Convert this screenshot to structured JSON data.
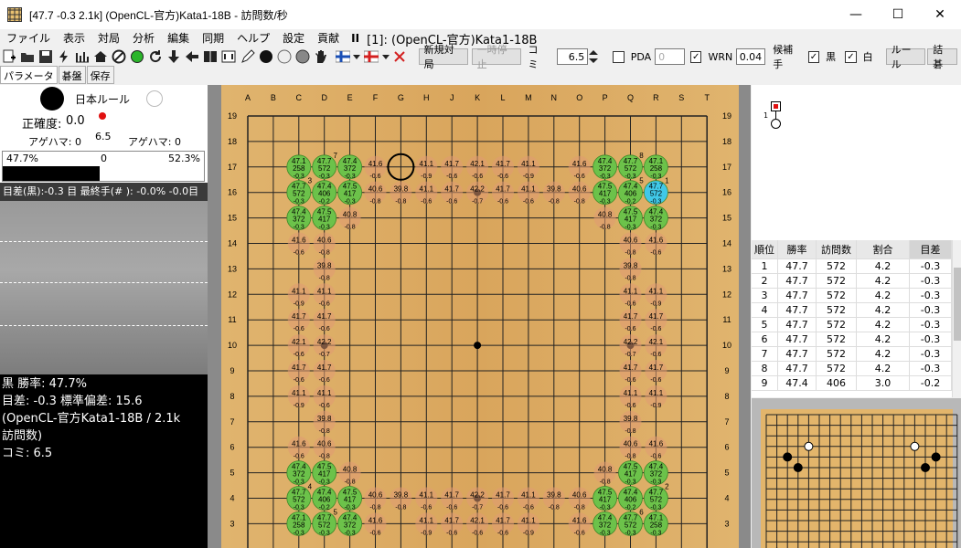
{
  "window": {
    "title": "[47.7 -0.3 2.1k] (OpenCL-官方)Kata1-18B - 訪問数/秒",
    "min": "—",
    "max": "☐",
    "close": "✕"
  },
  "menu": {
    "items": [
      "ファイル",
      "表示",
      "対局",
      "分析",
      "編集",
      "同期",
      "ヘルプ",
      "設定",
      "貢献"
    ],
    "pause": "II",
    "engine": "[1]: (OpenCL-官方)Kata1-18B"
  },
  "toolbar": {
    "new_game": "新規対局",
    "pause": "一時停止",
    "komi_label": "コミ",
    "komi_value": "6.5",
    "pda_label": "PDA",
    "pda_value": "0",
    "wrn_label": "WRN",
    "wrn_value": "0.04",
    "candidate_label": "候補手",
    "black_label": "黒",
    "white_label": "白",
    "rules": "ルール",
    "tsumego": "詰碁"
  },
  "tabs": [
    "パラメータ",
    "碁盤",
    "保存"
  ],
  "left": {
    "rule": "日本ルール",
    "accuracy_label": "正確度:",
    "accuracy_value": "0.0",
    "captures_black": "アゲハマ: 0",
    "captures_white": "アゲハマ: 0",
    "marker_value": "6.5",
    "winbar_black": "47.7%",
    "winbar_mid": "0",
    "winbar_white": "52.3%",
    "winbar_fraction": 0.477,
    "score_line": "目差(黒):-0.3 目 最終手(# ): -0.0% -0.0目"
  },
  "stats": {
    "line1": "黒 勝率: 47.7%",
    "line2": "目差: -0.3 標準偏差: 15.6",
    "line3": "(OpenCL-官方Kata1-18B / 2.1k",
    "line4": "訪問数)",
    "line5": "コミ: 6.5"
  },
  "board": {
    "cols": [
      "A",
      "B",
      "C",
      "D",
      "E",
      "F",
      "G",
      "H",
      "J",
      "K",
      "L",
      "M",
      "N",
      "O",
      "P",
      "Q",
      "R",
      "S",
      "T"
    ],
    "rows": [
      "19",
      "18",
      "17",
      "16",
      "15",
      "14",
      "13",
      "12",
      "11",
      "10",
      "9",
      "8",
      "7",
      "6",
      "5",
      "4",
      "3"
    ]
  },
  "table": {
    "headers": [
      "順位",
      "勝率",
      "訪問数",
      "割合",
      "目差"
    ],
    "rows": [
      [
        "1",
        "47.7",
        "572",
        "4.2",
        "-0.3"
      ],
      [
        "2",
        "47.7",
        "572",
        "4.2",
        "-0.3"
      ],
      [
        "3",
        "47.7",
        "572",
        "4.2",
        "-0.3"
      ],
      [
        "4",
        "47.7",
        "572",
        "4.2",
        "-0.3"
      ],
      [
        "5",
        "47.7",
        "572",
        "4.2",
        "-0.3"
      ],
      [
        "6",
        "47.7",
        "572",
        "4.2",
        "-0.3"
      ],
      [
        "7",
        "47.7",
        "572",
        "4.2",
        "-0.3"
      ],
      [
        "8",
        "47.7",
        "572",
        "4.2",
        "-0.3"
      ],
      [
        "9",
        "47.4",
        "406",
        "3.0",
        "-0.2"
      ]
    ]
  },
  "tree": {
    "move_label": "1"
  },
  "colors": {
    "green": "#6cc24a",
    "greenDark": "#58b03a",
    "orange": "#e09a72",
    "cyan": "#40c8e8",
    "wood": "#d9a55c"
  },
  "board_marks": {
    "green": [
      {
        "c": "C",
        "r": "17",
        "w": "47.1",
        "v": "258",
        "s": "-0.3"
      },
      {
        "c": "D",
        "r": "17",
        "w": "47.7",
        "v": "572",
        "s": "-0.3",
        "n": "7"
      },
      {
        "c": "E",
        "r": "17",
        "w": "47.4",
        "v": "372",
        "s": "-0.3"
      },
      {
        "c": "C",
        "r": "16",
        "w": "47.7",
        "v": "572",
        "s": "-0.3",
        "n": "3"
      },
      {
        "c": "D",
        "r": "16",
        "w": "47.4",
        "v": "406",
        "s": "-0.2"
      },
      {
        "c": "E",
        "r": "16",
        "w": "47.5",
        "v": "417",
        "s": "-0.3"
      },
      {
        "c": "C",
        "r": "15",
        "w": "47.4",
        "v": "372",
        "s": "-0.3"
      },
      {
        "c": "D",
        "r": "15",
        "w": "47.5",
        "v": "417",
        "s": "-0.3"
      },
      {
        "c": "P",
        "r": "17",
        "w": "47.4",
        "v": "372",
        "s": "-0.3"
      },
      {
        "c": "Q",
        "r": "17",
        "w": "47.7",
        "v": "572",
        "s": "-0.3",
        "n": "8"
      },
      {
        "c": "R",
        "r": "17",
        "w": "47.1",
        "v": "258",
        "s": "-0.3"
      },
      {
        "c": "P",
        "r": "16",
        "w": "47.5",
        "v": "417",
        "s": "-0.3"
      },
      {
        "c": "Q",
        "r": "16",
        "w": "47.4",
        "v": "406",
        "s": "-0.2",
        "n": "5"
      },
      {
        "c": "Q",
        "r": "15",
        "w": "47.5",
        "v": "417",
        "s": "-0.3"
      },
      {
        "c": "R",
        "r": "15",
        "w": "47.4",
        "v": "372",
        "s": "-0.3"
      },
      {
        "c": "C",
        "r": "5",
        "w": "47.4",
        "v": "372",
        "s": "-0.3"
      },
      {
        "c": "D",
        "r": "5",
        "w": "47.5",
        "v": "417",
        "s": "-0.3"
      },
      {
        "c": "C",
        "r": "4",
        "w": "47.7",
        "v": "572",
        "s": "-0.3",
        "n": "4"
      },
      {
        "c": "D",
        "r": "4",
        "w": "47.4",
        "v": "406",
        "s": "-0.2"
      },
      {
        "c": "E",
        "r": "4",
        "w": "47.5",
        "v": "417",
        "s": "-0.3"
      },
      {
        "c": "C",
        "r": "3",
        "w": "47.1",
        "v": "258",
        "s": "-0.3"
      },
      {
        "c": "D",
        "r": "3",
        "w": "47.7",
        "v": "572",
        "s": "-0.3",
        "n": "5"
      },
      {
        "c": "E",
        "r": "3",
        "w": "47.4",
        "v": "372",
        "s": "-0.3"
      },
      {
        "c": "Q",
        "r": "5",
        "w": "47.5",
        "v": "417",
        "s": "-0.3"
      },
      {
        "c": "R",
        "r": "5",
        "w": "47.4",
        "v": "372",
        "s": "-0.3"
      },
      {
        "c": "P",
        "r": "4",
        "w": "47.5",
        "v": "417",
        "s": "-0.3"
      },
      {
        "c": "Q",
        "r": "4",
        "w": "47.4",
        "v": "406",
        "s": "-0.2"
      },
      {
        "c": "R",
        "r": "4",
        "w": "47.7",
        "v": "572",
        "s": "-0.3",
        "n": "2"
      },
      {
        "c": "P",
        "r": "3",
        "w": "47.4",
        "v": "372",
        "s": "-0.3"
      },
      {
        "c": "Q",
        "r": "3",
        "w": "47.7",
        "v": "572",
        "s": "-0.3",
        "n": "6"
      },
      {
        "c": "R",
        "r": "3",
        "w": "47.1",
        "v": "258",
        "s": "-0.3"
      }
    ],
    "best": {
      "c": "R",
      "r": "16",
      "w": "47.7",
      "v": "572",
      "s": "-0.3",
      "n": "1"
    },
    "orange": [
      {
        "c": "F",
        "r": "17",
        "w": "41.6",
        "s": "-0.6"
      },
      {
        "c": "H",
        "r": "17",
        "w": "41.1",
        "s": "-0.9"
      },
      {
        "c": "J",
        "r": "17",
        "w": "41.7",
        "s": "-0.6"
      },
      {
        "c": "K",
        "r": "17",
        "w": "42.1",
        "s": "-0.6"
      },
      {
        "c": "L",
        "r": "17",
        "w": "41.7",
        "s": "-0.6"
      },
      {
        "c": "M",
        "r": "17",
        "w": "41.1",
        "s": "-0.9"
      },
      {
        "c": "O",
        "r": "17",
        "w": "41.6",
        "s": "-0.6"
      },
      {
        "c": "F",
        "r": "16",
        "w": "40.6",
        "s": "-0.8"
      },
      {
        "c": "G",
        "r": "16",
        "w": "39.8",
        "s": "-0.8"
      },
      {
        "c": "H",
        "r": "16",
        "w": "41.1",
        "s": "-0.6"
      },
      {
        "c": "J",
        "r": "16",
        "w": "41.7",
        "s": "-0.6"
      },
      {
        "c": "K",
        "r": "16",
        "w": "42.2",
        "s": "-0.7"
      },
      {
        "c": "L",
        "r": "16",
        "w": "41.7",
        "s": "-0.6"
      },
      {
        "c": "M",
        "r": "16",
        "w": "41.1",
        "s": "-0.6"
      },
      {
        "c": "N",
        "r": "16",
        "w": "39.8",
        "s": "-0.8"
      },
      {
        "c": "O",
        "r": "16",
        "w": "40.6",
        "s": "-0.8"
      },
      {
        "c": "E",
        "r": "15",
        "w": "40.8",
        "s": "-0.8"
      },
      {
        "c": "P",
        "r": "15",
        "w": "40.8",
        "s": "-0.8"
      },
      {
        "c": "C",
        "r": "14",
        "w": "41.6",
        "s": "-0.6"
      },
      {
        "c": "D",
        "r": "14",
        "w": "40.6",
        "s": "-0.8"
      },
      {
        "c": "Q",
        "r": "14",
        "w": "40.6",
        "s": "-0.8"
      },
      {
        "c": "R",
        "r": "14",
        "w": "41.6",
        "s": "-0.6"
      },
      {
        "c": "D",
        "r": "13",
        "w": "39.8",
        "s": "-0.8"
      },
      {
        "c": "Q",
        "r": "13",
        "w": "39.8",
        "s": "-0.8"
      },
      {
        "c": "C",
        "r": "12",
        "w": "41.1",
        "s": "-0.9"
      },
      {
        "c": "D",
        "r": "12",
        "w": "41.1",
        "s": "-0.6"
      },
      {
        "c": "Q",
        "r": "12",
        "w": "41.1",
        "s": "-0.6"
      },
      {
        "c": "R",
        "r": "12",
        "w": "41.1",
        "s": "-0.9"
      },
      {
        "c": "C",
        "r": "11",
        "w": "41.7",
        "s": "-0.6"
      },
      {
        "c": "D",
        "r": "11",
        "w": "41.7",
        "s": "-0.6"
      },
      {
        "c": "Q",
        "r": "11",
        "w": "41.7",
        "s": "-0.6"
      },
      {
        "c": "R",
        "r": "11",
        "w": "41.7",
        "s": "-0.6"
      },
      {
        "c": "C",
        "r": "10",
        "w": "42.1",
        "s": "-0.6"
      },
      {
        "c": "D",
        "r": "10",
        "w": "42.2",
        "s": "-0.7"
      },
      {
        "c": "Q",
        "r": "10",
        "w": "42.2",
        "s": "-0.7"
      },
      {
        "c": "R",
        "r": "10",
        "w": "42.1",
        "s": "-0.6"
      },
      {
        "c": "C",
        "r": "9",
        "w": "41.7",
        "s": "-0.6"
      },
      {
        "c": "D",
        "r": "9",
        "w": "41.7",
        "s": "-0.6"
      },
      {
        "c": "Q",
        "r": "9",
        "w": "41.7",
        "s": "-0.6"
      },
      {
        "c": "R",
        "r": "9",
        "w": "41.7",
        "s": "-0.6"
      },
      {
        "c": "C",
        "r": "8",
        "w": "41.1",
        "s": "-0.9"
      },
      {
        "c": "D",
        "r": "8",
        "w": "41.1",
        "s": "-0.6"
      },
      {
        "c": "Q",
        "r": "8",
        "w": "41.1",
        "s": "-0.6"
      },
      {
        "c": "R",
        "r": "8",
        "w": "41.1",
        "s": "-0.9"
      },
      {
        "c": "D",
        "r": "7",
        "w": "39.8",
        "s": "-0.8"
      },
      {
        "c": "Q",
        "r": "7",
        "w": "39.8",
        "s": "-0.8"
      },
      {
        "c": "C",
        "r": "6",
        "w": "41.6",
        "s": "-0.6"
      },
      {
        "c": "D",
        "r": "6",
        "w": "40.6",
        "s": "-0.8"
      },
      {
        "c": "Q",
        "r": "6",
        "w": "40.6",
        "s": "-0.8"
      },
      {
        "c": "R",
        "r": "6",
        "w": "41.6",
        "s": "-0.6"
      },
      {
        "c": "E",
        "r": "5",
        "w": "40.8",
        "s": "-0.8"
      },
      {
        "c": "P",
        "r": "5",
        "w": "40.8",
        "s": "-0.8"
      },
      {
        "c": "F",
        "r": "4",
        "w": "40.6",
        "s": "-0.8"
      },
      {
        "c": "G",
        "r": "4",
        "w": "39.8",
        "s": "-0.8"
      },
      {
        "c": "H",
        "r": "4",
        "w": "41.1",
        "s": "-0.6"
      },
      {
        "c": "J",
        "r": "4",
        "w": "41.7",
        "s": "-0.6"
      },
      {
        "c": "K",
        "r": "4",
        "w": "42.2",
        "s": "-0.7"
      },
      {
        "c": "L",
        "r": "4",
        "w": "41.7",
        "s": "-0.6"
      },
      {
        "c": "M",
        "r": "4",
        "w": "41.1",
        "s": "-0.6"
      },
      {
        "c": "N",
        "r": "4",
        "w": "39.8",
        "s": "-0.8"
      },
      {
        "c": "O",
        "r": "4",
        "w": "40.6",
        "s": "-0.8"
      },
      {
        "c": "F",
        "r": "3",
        "w": "41.6",
        "s": "-0.6"
      },
      {
        "c": "H",
        "r": "3",
        "w": "41.1",
        "s": "-0.9"
      },
      {
        "c": "J",
        "r": "3",
        "w": "41.7",
        "s": "-0.6"
      },
      {
        "c": "K",
        "r": "3",
        "w": "42.1",
        "s": "-0.6"
      },
      {
        "c": "L",
        "r": "3",
        "w": "41.7",
        "s": "-0.6"
      },
      {
        "c": "M",
        "r": "3",
        "w": "41.1",
        "s": "-0.9"
      },
      {
        "c": "O",
        "r": "3",
        "w": "41.6",
        "s": "-0.6"
      }
    ],
    "hoshi": [
      [
        "D",
        "16"
      ],
      [
        "K",
        "16"
      ],
      [
        "Q",
        "16"
      ],
      [
        "D",
        "10"
      ],
      [
        "K",
        "10"
      ],
      [
        "Q",
        "10"
      ],
      [
        "D",
        "4"
      ],
      [
        "K",
        "4"
      ],
      [
        "Q",
        "4"
      ]
    ],
    "last_move_ring": {
      "c": "G",
      "r": "17"
    }
  }
}
